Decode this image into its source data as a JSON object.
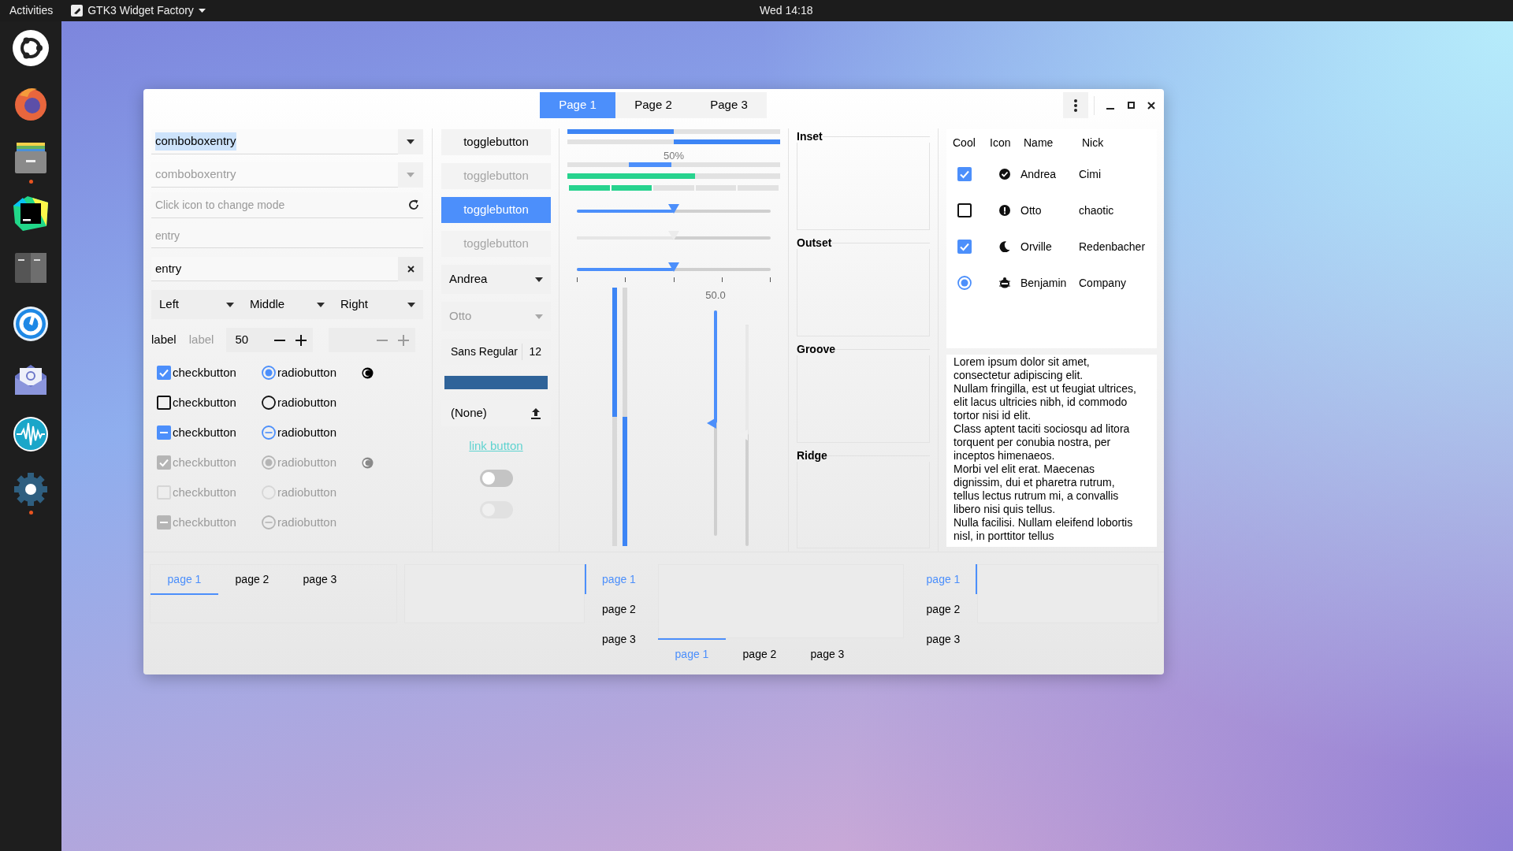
{
  "top_bar": {
    "activities": "Activities",
    "app_menu": "GTK3 Widget Factory",
    "clock": "Wed 14:18"
  },
  "dock": [
    {
      "kind": "ring",
      "running": false
    },
    {
      "kind": "globe",
      "running": false
    },
    {
      "kind": "drawer",
      "running": true
    },
    {
      "kind": "ide",
      "running": false
    },
    {
      "kind": "terminal",
      "running": false
    },
    {
      "kind": "gauge",
      "running": false
    },
    {
      "kind": "mail",
      "running": false
    },
    {
      "kind": "wave",
      "running": false
    },
    {
      "kind": "gear",
      "running": true
    }
  ],
  "window": {
    "tabs": [
      {
        "label": "Page 1",
        "selected": true
      },
      {
        "label": "Page 2",
        "selected": false
      },
      {
        "label": "Page 3",
        "selected": false
      }
    ]
  },
  "entries": [
    {
      "kind": "combo",
      "value": "comboboxentry",
      "text_selected": true,
      "disabled": false
    },
    {
      "kind": "combo",
      "value": "comboboxentry",
      "text_selected": false,
      "disabled": true
    },
    {
      "kind": "mode",
      "placeholder": "Click icon to change mode"
    },
    {
      "kind": "plain",
      "placeholder": "entry"
    },
    {
      "kind": "clear",
      "value": "entry"
    }
  ],
  "dropdowns": [
    {
      "label": "Left"
    },
    {
      "label": "Middle"
    },
    {
      "label": "Right"
    }
  ],
  "labels": [
    {
      "text": "label",
      "disabled": false
    },
    {
      "text": "label",
      "disabled": true
    }
  ],
  "spin_buttons": [
    {
      "value": "50",
      "disabled": false
    },
    {
      "disabled": true
    }
  ],
  "check_rows": [
    {
      "check": {
        "label": "checkbutton",
        "checked": true,
        "inconsistent": false
      },
      "radio": {
        "label": "radiobutton",
        "checked": true,
        "inconsistent": false
      },
      "bare_radio": true,
      "disabled": false
    },
    {
      "check": {
        "label": "checkbutton",
        "checked": false,
        "inconsistent": false
      },
      "radio": {
        "label": "radiobutton",
        "checked": false,
        "inconsistent": false
      },
      "bare_radio": false,
      "disabled": false
    },
    {
      "check": {
        "label": "checkbutton",
        "checked": false,
        "inconsistent": true
      },
      "radio": {
        "label": "radiobutton",
        "checked": false,
        "inconsistent": true
      },
      "bare_radio": false,
      "disabled": false
    },
    {
      "check": {
        "label": "checkbutton",
        "checked": true,
        "inconsistent": false
      },
      "radio": {
        "label": "radiobutton",
        "checked": true,
        "inconsistent": false
      },
      "bare_radio": true,
      "disabled": true
    },
    {
      "check": {
        "label": "checkbutton",
        "checked": false,
        "inconsistent": false
      },
      "radio": {
        "label": "radiobutton",
        "checked": false,
        "inconsistent": false
      },
      "bare_radio": false,
      "disabled": true
    },
    {
      "check": {
        "label": "checkbutton",
        "checked": false,
        "inconsistent": true
      },
      "radio": {
        "label": "radiobutton",
        "checked": false,
        "inconsistent": true
      },
      "bare_radio": false,
      "disabled": true
    }
  ],
  "toggle_buttons": [
    {
      "label": "togglebutton",
      "active": false,
      "disabled": false
    },
    {
      "label": "togglebutton",
      "active": false,
      "disabled": true
    },
    {
      "label": "togglebutton",
      "active": true,
      "disabled": false
    },
    {
      "label": "togglebutton",
      "active": false,
      "disabled": true
    }
  ],
  "combo_boxes": [
    {
      "value": "Andrea",
      "disabled": false
    },
    {
      "value": "Otto",
      "disabled": true
    }
  ],
  "font_button": {
    "family": "Sans Regular",
    "size": "12"
  },
  "color_button": {
    "color": "#2f6399"
  },
  "file_chooser": {
    "label": "(None)"
  },
  "link_button": {
    "label": "link button"
  },
  "switches": [
    {
      "on": false,
      "disabled": false
    },
    {
      "on": false,
      "disabled": true
    }
  ],
  "progress_bars": [
    {
      "kind": "progress",
      "level": 0.5,
      "inverted": false
    },
    {
      "kind": "progress",
      "level": 0.5,
      "inverted": true
    },
    {
      "kind": "activity",
      "text": "50%"
    },
    {
      "kind": "level",
      "level": 0.6
    },
    {
      "kind": "segmented",
      "level": 0.4
    }
  ],
  "scales": [
    {
      "level": 0.5,
      "disabled": false,
      "marks": false
    },
    {
      "level": 0.5,
      "disabled": true,
      "marks": false
    },
    {
      "level": 0.5,
      "disabled": false,
      "marks": true
    }
  ],
  "vertical_progress": [
    {
      "level": 0.5,
      "inverted": true
    },
    {
      "level": 0.5,
      "inverted": false
    }
  ],
  "vertical_scales": [
    {
      "level": 0.5,
      "value": "50.0",
      "disabled": false
    },
    {
      "level": 0.5,
      "disabled": true
    }
  ],
  "frames": [
    {
      "label": "Inset"
    },
    {
      "label": "Outset"
    },
    {
      "label": "Groove"
    },
    {
      "label": "Ridge"
    }
  ],
  "tree": {
    "columns": [
      "Cool",
      "Icon",
      "Name",
      "Nick"
    ],
    "rows": [
      {
        "kind": "check",
        "checked": true,
        "name": "Andrea",
        "nick": "Cimi"
      },
      {
        "kind": "check",
        "checked": false,
        "name": "Otto",
        "nick": "chaotic"
      },
      {
        "kind": "check",
        "checked": true,
        "name": "Orville",
        "nick": "Redenbacher"
      },
      {
        "kind": "radio",
        "checked": true,
        "name": "Benjamin",
        "nick": "Company"
      }
    ]
  },
  "text_view": {
    "paragraphs": [
      "Lorem ipsum dolor sit amet, consectetur adipiscing elit.",
      "Nullam fringilla, est ut feugiat ultrices, elit lacus ultricies nibh, id commodo tortor nisi id elit.",
      "Class aptent taciti sociosqu ad litora torquent per conubia nostra, per inceptos himenaeos.",
      "Morbi vel elit erat. Maecenas dignissim, dui et pharetra rutrum, tellus lectus rutrum mi, a convallis libero nisi quis tellus.",
      "Nulla facilisi. Nullam eleifend lobortis nisl, in porttitor tellus"
    ]
  },
  "notebooks": [
    {
      "kind": "top",
      "tabs": [
        {
          "label": "page 1",
          "selected": true
        },
        {
          "label": "page 2",
          "selected": false
        },
        {
          "label": "page 3",
          "selected": false
        }
      ]
    },
    {
      "kind": "right",
      "tabs": [
        {
          "label": "page 1",
          "selected": true
        },
        {
          "label": "page 2",
          "selected": false
        },
        {
          "label": "page 3",
          "selected": false
        }
      ]
    },
    {
      "kind": "bottom",
      "tabs": [
        {
          "label": "page 1",
          "selected": true
        },
        {
          "label": "page 2",
          "selected": false
        },
        {
          "label": "page 3",
          "selected": false
        }
      ]
    },
    {
      "kind": "left",
      "tabs": [
        {
          "label": "page 1",
          "selected": true
        },
        {
          "label": "page 2",
          "selected": false
        },
        {
          "label": "page 3",
          "selected": false
        }
      ]
    }
  ]
}
